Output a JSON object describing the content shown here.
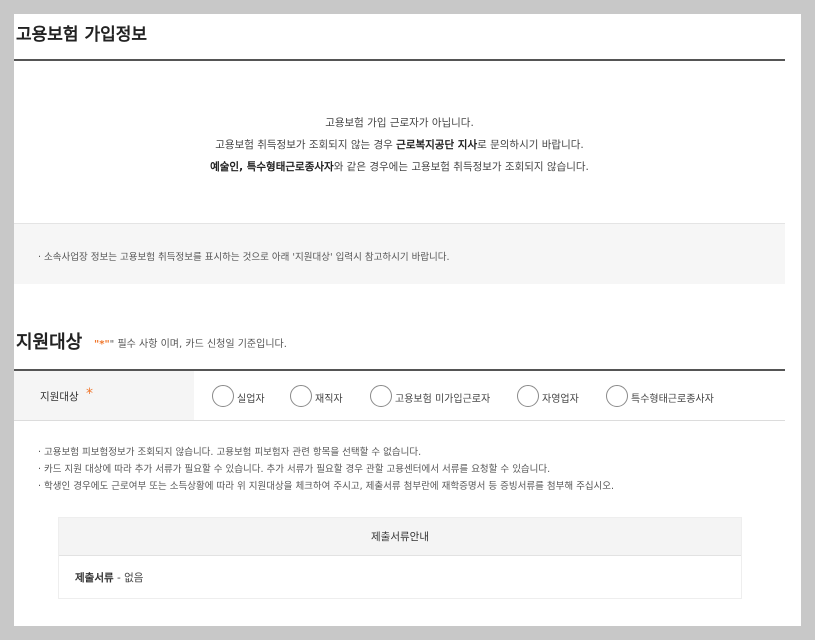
{
  "section": {
    "title": "고용보험 가입정보"
  },
  "info": {
    "line1": "고용보험 가입 근로자가 아닙니다.",
    "line2_pre": "고용보험 취득정보가 조회되지 않는 경우 ",
    "line2_bold": "근로복지공단 지사",
    "line2_post": "로 문의하시기 바랍니다.",
    "line3_bold": "예술인, 특수형태근로종사자",
    "line3_post": "와 같은 경우에는 고용보험 취득정보가 조회되지 않습니다."
  },
  "note": {
    "text": "· 소속사업장 정보는 고용보험 취득정보를 표시하는 것으로 아래 '지원대상' 입력시 참고하시기 바랍니다."
  },
  "target": {
    "title": "지원대상",
    "note_open": "\"",
    "note_star": "*",
    "note_rest": "\" 필수 사항 이며, 카드 신청일 기준입니다.",
    "row_label": "지원대상",
    "row_star": "*",
    "options": [
      "실업자",
      "재직자",
      "고용보험 미가입근로자",
      "자영업자",
      "특수형태근로종사자"
    ]
  },
  "bullets": [
    "· 고용보험 피보험정보가 조회되지 않습니다. 고용보험 피보험자 관련 항목을 선택할 수 없습니다.",
    "· 카드 지원 대상에 따라 추가 서류가 필요할 수 있습니다. 추가 서류가 필요할 경우 관할 고용센터에서 서류를 요청할 수 있습니다.",
    "· 학생인 경우에도 근로여부 또는 소득상황에 따라 위 지원대상을 체크하여 주시고, 제출서류 첨부란에 재학증명서 등 증빙서류를 첨부해 주십시오."
  ],
  "docs": {
    "header": "제출서류안내",
    "label": "제출서류",
    "value": " - 없음"
  }
}
